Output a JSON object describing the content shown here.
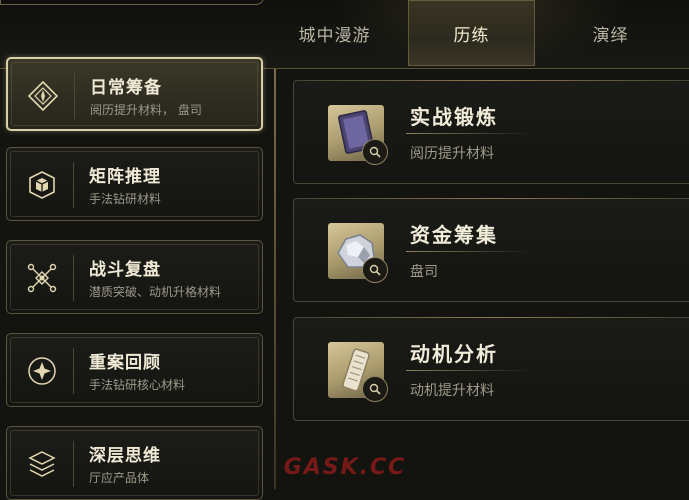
{
  "tabs": [
    {
      "label": "城中漫游",
      "active": false
    },
    {
      "label": "历练",
      "active": true
    },
    {
      "label": "演绎",
      "active": false
    }
  ],
  "sidebar": {
    "items": [
      {
        "title": "日常筹备",
        "subtitle": "阅历提升材料， 盘司",
        "icon": "compass-diamond-icon",
        "active": true
      },
      {
        "title": "矩阵推理",
        "subtitle": "手法钻研材料",
        "icon": "cube-icon",
        "active": false
      },
      {
        "title": "战斗复盘",
        "subtitle": "潜质突破、动机升格材料",
        "icon": "network-nodes-icon",
        "active": false
      },
      {
        "title": "重案回顾",
        "subtitle": "手法钻研核心材料",
        "icon": "spiral-star-icon",
        "active": false
      },
      {
        "title": "深层思维",
        "subtitle": "厅应产品体",
        "icon": "stacked-layers-icon",
        "active": false
      }
    ]
  },
  "cards": [
    {
      "title": "实战锻炼",
      "subtitle": "阅历提升材料",
      "icon": "purple-book-icon"
    },
    {
      "title": "资金筹集",
      "subtitle": "盘司",
      "icon": "silver-ore-icon"
    },
    {
      "title": "动机分析",
      "subtitle": "动机提升材料",
      "icon": "scroll-tablet-icon"
    }
  ],
  "watermark": "GASK.CC",
  "colors": {
    "background": "#131410",
    "accent_gold": "#d9cfa6",
    "text_primary": "#efe9d6",
    "text_secondary": "#9d998b",
    "watermark": "#c81e1e"
  }
}
